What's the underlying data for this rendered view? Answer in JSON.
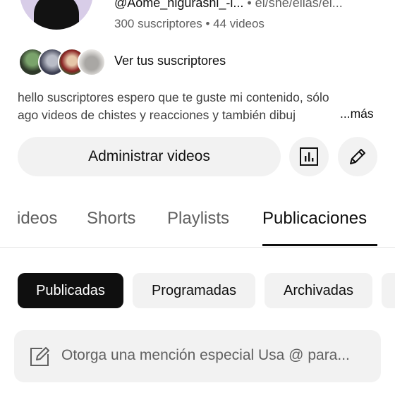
{
  "channel": {
    "handle": "@Aome_higurashi_-i...",
    "pronouns": "• el/she/ellas/el...",
    "subscribers": "300 suscriptores",
    "separator": "•",
    "videos": "44 videos",
    "subscribers_link": "Ver tus suscriptores",
    "description_line1": "hello suscriptores espero que te guste mi contenido, sólo",
    "description_line2": "ago videos de chistes y reacciones y también dibuj",
    "more_label": "...más"
  },
  "actions": {
    "manage_videos": "Administrar videos",
    "analytics_icon": "analytics-icon",
    "edit_icon": "pencil-icon"
  },
  "tabs": [
    {
      "label": "ideos",
      "active": false
    },
    {
      "label": "Shorts",
      "active": false
    },
    {
      "label": "Playlists",
      "active": false
    },
    {
      "label": "Publicaciones",
      "active": true
    }
  ],
  "chips": [
    {
      "label": "Publicadas",
      "active": true
    },
    {
      "label": "Programadas",
      "active": false
    },
    {
      "label": "Archivadas",
      "active": false
    }
  ],
  "post_box": {
    "placeholder": "Otorga una mención especial Usa @ para..."
  },
  "colors": {
    "text_primary": "#0f0f0f",
    "text_secondary": "#606060",
    "chip_bg": "#f2f2f2",
    "chip_active_bg": "#0f0f0f"
  }
}
